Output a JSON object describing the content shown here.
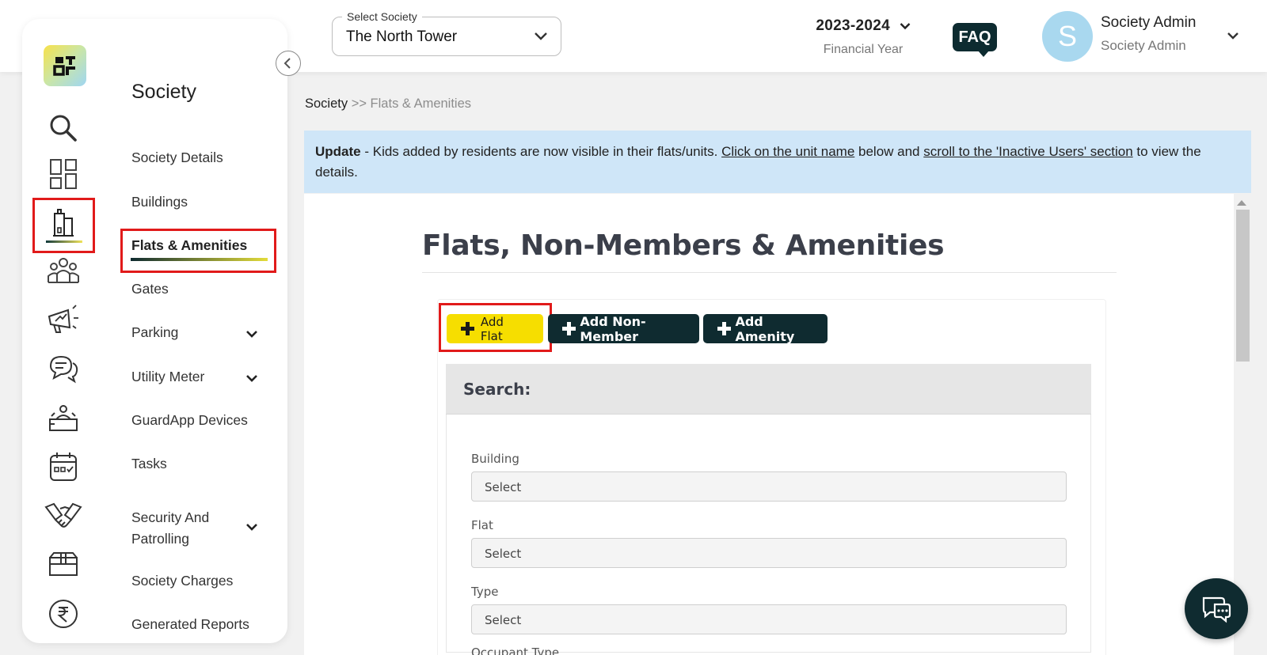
{
  "header": {
    "society_select_label": "Select Society",
    "society_select_value": "The North Tower",
    "financial_year_value": "2023-2024",
    "financial_year_label": "Financial Year",
    "faq_label": "FAQ",
    "avatar_initial": "S",
    "user_name": "Society Admin",
    "user_role": "Society Admin"
  },
  "sidebar": {
    "title": "Society",
    "icons": [
      "search-icon",
      "dashboard-grid-icon",
      "building-icon",
      "members-group-icon",
      "megaphone-icon",
      "chat-bubbles-icon",
      "reception-desk-icon",
      "calendar-icon",
      "handshake-icon",
      "box-icon",
      "rupee-icon"
    ],
    "items": [
      {
        "label": "Society Details"
      },
      {
        "label": "Buildings"
      },
      {
        "label": "Flats & Amenities"
      },
      {
        "label": "Gates"
      },
      {
        "label": "Parking"
      },
      {
        "label": "Utility Meter"
      },
      {
        "label": "GuardApp Devices"
      },
      {
        "label": "Tasks"
      },
      {
        "label": "Security And Patrolling"
      },
      {
        "label": "Society Charges"
      },
      {
        "label": "Generated Reports"
      }
    ]
  },
  "breadcrumb": {
    "root": "Society",
    "rest": ">> Flats & Amenities"
  },
  "banner": {
    "bold": "Update",
    "text1": " - Kids added by residents are now visible in their flats/units. ",
    "link1": "Click on the unit name",
    "text2": " below and ",
    "link2": "scroll to the 'Inactive Users' section",
    "text3": " to view the details."
  },
  "main": {
    "title": "Flats, Non-Members & Amenities",
    "buttons": {
      "add_flat": "Add Flat",
      "add_non_member": "Add Non-Member",
      "add_amenity": "Add Amenity"
    },
    "search": {
      "heading": "Search:",
      "fields": [
        {
          "label": "Building",
          "value": "Select"
        },
        {
          "label": "Flat",
          "value": "Select"
        },
        {
          "label": "Type",
          "value": "Select"
        }
      ],
      "cut_label": "Occupant Type"
    }
  },
  "colors": {
    "accent_dark": "#0f2b30",
    "accent_yellow": "#f6de00",
    "highlight_red": "#e11a1a",
    "banner_bg": "#cfe6f8"
  }
}
